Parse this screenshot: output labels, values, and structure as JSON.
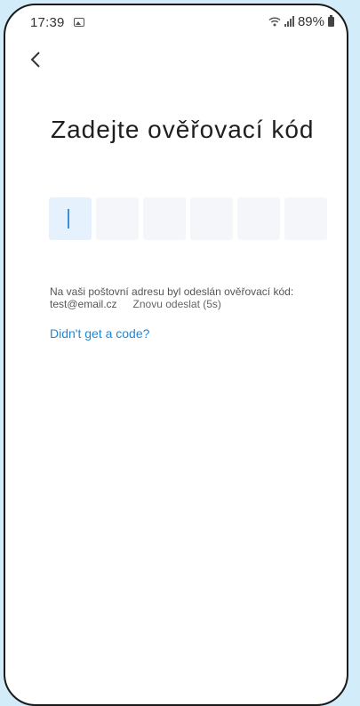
{
  "status_bar": {
    "time": "17:39",
    "battery": "89%",
    "icons": [
      "gallery-icon",
      "wifi-icon",
      "signal-icon",
      "battery-icon"
    ]
  },
  "nav": {
    "back_icon": "chevron-left-icon"
  },
  "page": {
    "title": "Zadejte ověřovací kód",
    "code_length": 6,
    "info_line": "Na vaši poštovní adresu byl odeslán ověřovací kód:",
    "email": "test@email.cz",
    "resend": "Znovu odeslat (5s)",
    "help_link": "Didn't get a code?"
  },
  "colors": {
    "background": "#d3ecf9",
    "link": "#1e88d8",
    "caret": "#3c8fe0",
    "cell": "#f4f6fa",
    "cell_active": "#e5f1fd"
  }
}
